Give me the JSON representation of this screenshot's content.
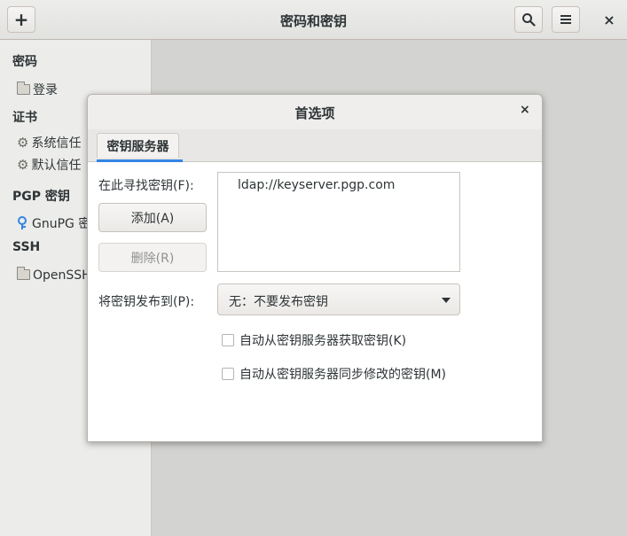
{
  "window": {
    "title": "密码和密钥",
    "add_label": "+",
    "close_label": "×"
  },
  "sidebar": {
    "sections": [
      {
        "title": "密码",
        "items": [
          {
            "label": "登录",
            "icon": "folder-icon"
          }
        ]
      },
      {
        "title": "证书",
        "items": [
          {
            "label": "系统信任",
            "icon": "gear-icon"
          },
          {
            "label": "默认信任",
            "icon": "gear-icon"
          }
        ]
      },
      {
        "title": "PGP 密钥",
        "items": [
          {
            "label": "GnuPG 密钥",
            "icon": "key-icon"
          }
        ]
      },
      {
        "title": "SSH",
        "items": [
          {
            "label": "OpenSSH 密钥",
            "icon": "folder-icon"
          }
        ]
      }
    ]
  },
  "dialog": {
    "title": "首选项",
    "close_label": "×",
    "tab_label": "密钥服务器",
    "search_label": "在此寻找密钥(F):",
    "add_button": "添加(A)",
    "remove_button": "删除(R)",
    "servers": [
      "ldap://keyserver.pgp.com"
    ],
    "publish_label": "将密钥发布到(P):",
    "publish_value": "无：不要发布密钥",
    "auto_retrieve_label": "自动从密钥服务器获取密钥(K)",
    "auto_sync_label": "自动从密钥服务器同步修改的密钥(M)",
    "auto_retrieve_checked": false,
    "auto_sync_checked": false
  },
  "colors": {
    "accent": "#3584e4"
  }
}
